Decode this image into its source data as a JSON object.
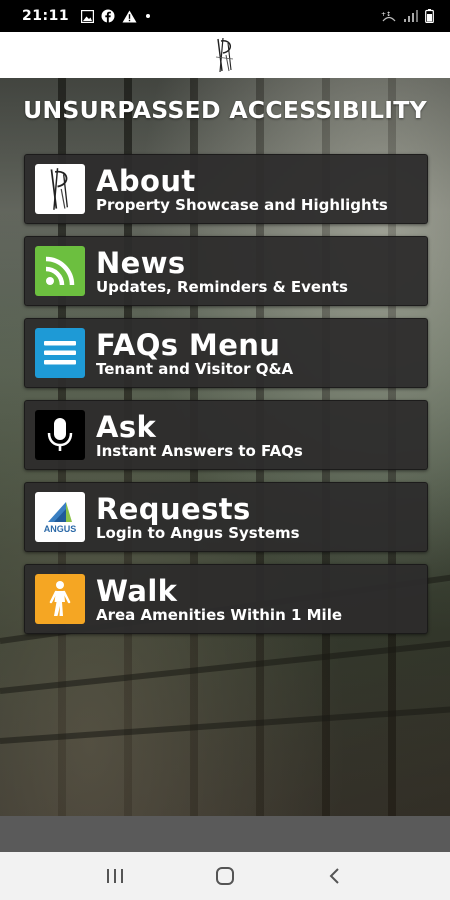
{
  "status_bar": {
    "time": "21:11",
    "notification_icons": [
      "gallery-icon",
      "facebook-icon",
      "warning-icon",
      "dot-icon"
    ],
    "system_icons": [
      "wifi-icon",
      "signal-icon",
      "battery-icon"
    ]
  },
  "app_bar": {
    "logo": "property-logo-icon"
  },
  "main": {
    "headline": "UNSURPASSED ACCESSIBILITY",
    "menu": [
      {
        "title": "About",
        "subtitle": "Property Showcase and Highlights",
        "icon": "property-logo-icon",
        "icon_bg": "#ffffff"
      },
      {
        "title": "News",
        "subtitle": "Updates, Reminders & Events",
        "icon": "rss-icon",
        "icon_bg": "#6cbf3f"
      },
      {
        "title": "FAQs Menu",
        "subtitle": "Tenant and Visitor Q&A",
        "icon": "menu-lines-icon",
        "icon_bg": "#1e9ad6"
      },
      {
        "title": "Ask",
        "subtitle": "Instant Answers to FAQs",
        "icon": "microphone-icon",
        "icon_bg": "#000000"
      },
      {
        "title": "Requests",
        "subtitle": "Login to Angus Systems",
        "icon": "angus-logo-icon",
        "icon_bg": "#ffffff",
        "icon_text": "ANGUS"
      },
      {
        "title": "Walk",
        "subtitle": "Area Amenities Within 1 Mile",
        "icon": "pedestrian-icon",
        "icon_bg": "#f5a623"
      }
    ]
  },
  "nav_bar": {
    "buttons": [
      "recent-apps-icon",
      "home-icon",
      "back-icon"
    ]
  }
}
